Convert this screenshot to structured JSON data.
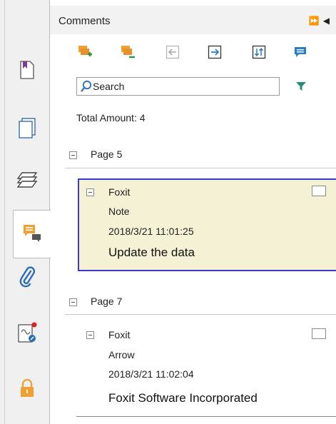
{
  "panel": {
    "title": "Comments",
    "controls": "⏩ ◀"
  },
  "left_rail": {
    "items": [
      {
        "name": "bookmark-icon"
      },
      {
        "name": "pages-icon"
      },
      {
        "name": "layers-icon"
      },
      {
        "name": "comments-icon",
        "active": true
      },
      {
        "name": "attachment-icon"
      },
      {
        "name": "signature-icon"
      },
      {
        "name": "lock-icon"
      }
    ]
  },
  "toolbar": {
    "tools": [
      "expand-all-icon",
      "collapse-all-icon",
      "import-icon",
      "export-icon",
      "sort-icon",
      "comment-icon"
    ]
  },
  "search": {
    "placeholder": "Search"
  },
  "summary": {
    "total": "Total Amount: 4"
  },
  "groups": [
    {
      "page": "Page 5",
      "comments": [
        {
          "author": "Foxit",
          "type": "Note",
          "date": "2018/3/21 11:01:25",
          "content": "Update the data"
        }
      ]
    },
    {
      "page": "Page 7",
      "comments": [
        {
          "author": "Foxit",
          "type": "Arrow",
          "date": "2018/3/21 11:02:04",
          "content": "Foxit Software Incorporated"
        }
      ]
    }
  ],
  "colors": {
    "selected_bg": "#f5f1d5",
    "selected_border": "#3a3ad0",
    "tool_orange": "#f0a030",
    "tool_blue": "#2a7fc4",
    "filter_teal": "#2a8a7a"
  }
}
